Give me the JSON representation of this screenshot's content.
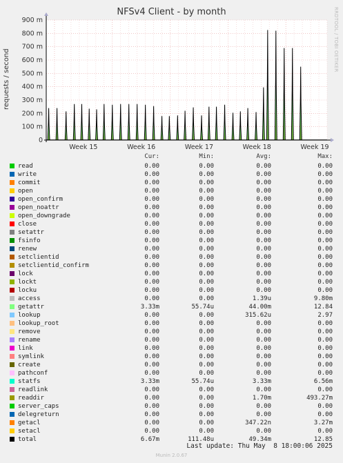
{
  "title": "NFSv4 Client - by month",
  "side_text": "RRDTOOL / TOBI OETIKER",
  "ylabel": "requests / second",
  "chart_data": {
    "type": "line",
    "title": "NFSv4 Client - by month",
    "ylabel": "requests / second",
    "ylim": [
      0,
      900
    ],
    "yticks": [
      0,
      100,
      200,
      300,
      400,
      500,
      600,
      700,
      800,
      900
    ],
    "ytick_labels": [
      "0",
      "100 m",
      "200 m",
      "300 m",
      "400 m",
      "500 m",
      "600 m",
      "700 m",
      "800 m",
      "900 m"
    ],
    "x_unit_days": "days from start of graph (approx. 34 days shown)",
    "xlim": [
      0,
      34
    ],
    "xtick_labels": [
      {
        "label": "Week 15",
        "x": 4.5
      },
      {
        "label": "Week 16",
        "x": 11.5
      },
      {
        "label": "Week 17",
        "x": 18.5
      },
      {
        "label": "Week 18",
        "x": 25.5
      },
      {
        "label": "Week 19",
        "x": 32.5
      }
    ],
    "grid": true,
    "series": [
      {
        "name": "total",
        "color": "#000000",
        "peaks": [
          [
            0.3,
            240
          ],
          [
            1.3,
            240
          ],
          [
            2.4,
            215
          ],
          [
            3.4,
            270
          ],
          [
            4.3,
            270
          ],
          [
            5.2,
            235
          ],
          [
            6.1,
            230
          ],
          [
            7.0,
            270
          ],
          [
            8.0,
            265
          ],
          [
            9.0,
            270
          ],
          [
            10.0,
            270
          ],
          [
            11.0,
            270
          ],
          [
            12.0,
            265
          ],
          [
            13.0,
            255
          ],
          [
            14.0,
            180
          ],
          [
            14.9,
            180
          ],
          [
            15.9,
            185
          ],
          [
            16.8,
            220
          ],
          [
            17.8,
            245
          ],
          [
            18.8,
            185
          ],
          [
            19.7,
            250
          ],
          [
            20.6,
            250
          ],
          [
            21.6,
            265
          ],
          [
            22.6,
            205
          ],
          [
            23.5,
            215
          ],
          [
            24.4,
            240
          ],
          [
            25.4,
            210
          ],
          [
            26.3,
            395
          ],
          [
            26.8,
            825
          ],
          [
            27.8,
            820
          ],
          [
            28.8,
            690
          ],
          [
            29.8,
            690
          ],
          [
            30.8,
            550
          ]
        ]
      },
      {
        "name": "getattr",
        "color": "#5AD95A"
      },
      {
        "name": "readdir",
        "color": "#7CA61D"
      }
    ]
  },
  "legend": {
    "headers": {
      "cur": "Cur:",
      "min": "Min:",
      "avg": "Avg:",
      "max": "Max:"
    },
    "rows": [
      {
        "name": "read",
        "color": "#00CC00",
        "cur": "0.00",
        "min": "0.00",
        "avg": "0.00",
        "max": "0.00"
      },
      {
        "name": "write",
        "color": "#0066B3",
        "cur": "0.00",
        "min": "0.00",
        "avg": "0.00",
        "max": "0.00"
      },
      {
        "name": "commit",
        "color": "#FF8000",
        "cur": "0.00",
        "min": "0.00",
        "avg": "0.00",
        "max": "0.00"
      },
      {
        "name": "open",
        "color": "#FFCC00",
        "cur": "0.00",
        "min": "0.00",
        "avg": "0.00",
        "max": "0.00"
      },
      {
        "name": "open_confirm",
        "color": "#330099",
        "cur": "0.00",
        "min": "0.00",
        "avg": "0.00",
        "max": "0.00"
      },
      {
        "name": "open_noattr",
        "color": "#990099",
        "cur": "0.00",
        "min": "0.00",
        "avg": "0.00",
        "max": "0.00"
      },
      {
        "name": "open_downgrade",
        "color": "#CCFF00",
        "cur": "0.00",
        "min": "0.00",
        "avg": "0.00",
        "max": "0.00"
      },
      {
        "name": "close",
        "color": "#FF0000",
        "cur": "0.00",
        "min": "0.00",
        "avg": "0.00",
        "max": "0.00"
      },
      {
        "name": "setattr",
        "color": "#808080",
        "cur": "0.00",
        "min": "0.00",
        "avg": "0.00",
        "max": "0.00"
      },
      {
        "name": "fsinfo",
        "color": "#008F00",
        "cur": "0.00",
        "min": "0.00",
        "avg": "0.00",
        "max": "0.00"
      },
      {
        "name": "renew",
        "color": "#00487D",
        "cur": "0.00",
        "min": "0.00",
        "avg": "0.00",
        "max": "0.00"
      },
      {
        "name": "setclientid",
        "color": "#B35A00",
        "cur": "0.00",
        "min": "0.00",
        "avg": "0.00",
        "max": "0.00"
      },
      {
        "name": "setclientid_confirm",
        "color": "#B38F00",
        "cur": "0.00",
        "min": "0.00",
        "avg": "0.00",
        "max": "0.00"
      },
      {
        "name": "lock",
        "color": "#6B006B",
        "cur": "0.00",
        "min": "0.00",
        "avg": "0.00",
        "max": "0.00"
      },
      {
        "name": "lockt",
        "color": "#8FB300",
        "cur": "0.00",
        "min": "0.00",
        "avg": "0.00",
        "max": "0.00"
      },
      {
        "name": "locku",
        "color": "#B30000",
        "cur": "0.00",
        "min": "0.00",
        "avg": "0.00",
        "max": "0.00"
      },
      {
        "name": "access",
        "color": "#BEBEBE",
        "cur": "0.00",
        "min": "0.00",
        "avg": "1.39u",
        "max": "9.80m"
      },
      {
        "name": "getattr",
        "color": "#80FF80",
        "cur": "3.33m",
        "min": "55.74u",
        "avg": "44.00m",
        "max": "12.84"
      },
      {
        "name": "lookup",
        "color": "#80C9FF",
        "cur": "0.00",
        "min": "0.00",
        "avg": "315.62u",
        "max": "2.97"
      },
      {
        "name": "lookup_root",
        "color": "#FFC080",
        "cur": "0.00",
        "min": "0.00",
        "avg": "0.00",
        "max": "0.00"
      },
      {
        "name": "remove",
        "color": "#FFE680",
        "cur": "0.00",
        "min": "0.00",
        "avg": "0.00",
        "max": "0.00"
      },
      {
        "name": "rename",
        "color": "#AA80FF",
        "cur": "0.00",
        "min": "0.00",
        "avg": "0.00",
        "max": "0.00"
      },
      {
        "name": "link",
        "color": "#EE00CC",
        "cur": "0.00",
        "min": "0.00",
        "avg": "0.00",
        "max": "0.00"
      },
      {
        "name": "symlink",
        "color": "#FF8080",
        "cur": "0.00",
        "min": "0.00",
        "avg": "0.00",
        "max": "0.00"
      },
      {
        "name": "create",
        "color": "#666600",
        "cur": "0.00",
        "min": "0.00",
        "avg": "0.00",
        "max": "0.00"
      },
      {
        "name": "pathconf",
        "color": "#FFBFFF",
        "cur": "0.00",
        "min": "0.00",
        "avg": "0.00",
        "max": "0.00"
      },
      {
        "name": "statfs",
        "color": "#00FFCC",
        "cur": "3.33m",
        "min": "55.74u",
        "avg": "3.33m",
        "max": "6.56m"
      },
      {
        "name": "readlink",
        "color": "#CC6699",
        "cur": "0.00",
        "min": "0.00",
        "avg": "0.00",
        "max": "0.00"
      },
      {
        "name": "readdir",
        "color": "#999900",
        "cur": "0.00",
        "min": "0.00",
        "avg": "1.70m",
        "max": "493.27m"
      },
      {
        "name": "server_caps",
        "color": "#00CC00",
        "cur": "0.00",
        "min": "0.00",
        "avg": "0.00",
        "max": "0.00"
      },
      {
        "name": "delegreturn",
        "color": "#0066B3",
        "cur": "0.00",
        "min": "0.00",
        "avg": "0.00",
        "max": "0.00"
      },
      {
        "name": "getacl",
        "color": "#FF8000",
        "cur": "0.00",
        "min": "0.00",
        "avg": "347.22n",
        "max": "3.27m"
      },
      {
        "name": "setacl",
        "color": "#FFCC00",
        "cur": "0.00",
        "min": "0.00",
        "avg": "0.00",
        "max": "0.00"
      },
      {
        "name": "total",
        "color": "#000000",
        "cur": "6.67m",
        "min": "111.48u",
        "avg": "49.34m",
        "max": "12.85"
      }
    ]
  },
  "last_update": "Last update: Thu May  8 18:00:06 2025",
  "munin_version": "Munin 2.0.67"
}
